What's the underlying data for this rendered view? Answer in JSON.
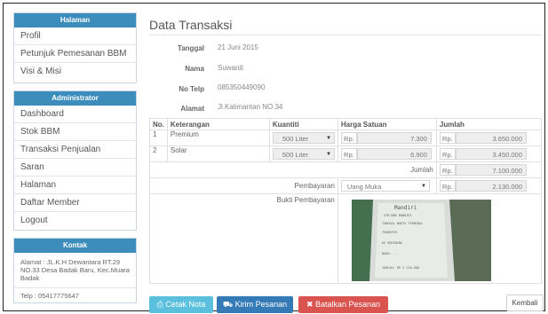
{
  "sidebar": {
    "halaman_title": "Halaman",
    "halaman_items": [
      "Profil",
      "Petunjuk Pemesanan BBM",
      "Visi & Misi"
    ],
    "admin_title": "Administrator",
    "admin_items": [
      "Dashboard",
      "Stok BBM",
      "Transaksi Penjualan",
      "Saran",
      "Halaman",
      "Daftar Member",
      "Logout"
    ],
    "kontak_title": "Kontak",
    "kontak_address": "Alamat : JL.K.H Dewantara RT.29 NO.33 Desa Badak Baru, Kec.Muara Badak",
    "kontak_phone": "Telp : 05417775647"
  },
  "main": {
    "title": "Data Transaksi",
    "info": {
      "tanggal_label": "Tanggal",
      "tanggal": "21 Juni 2015",
      "nama_label": "Nama",
      "nama": "Suwardi",
      "notelp_label": "No Telp",
      "notelp": "085350449090",
      "alamat_label": "Alamat",
      "alamat": "Jl.Kalimantan NO.34"
    },
    "table": {
      "headers": [
        "No.",
        "Keterangan",
        "Kuantiti",
        "Harga Satuan",
        "Jumlah"
      ],
      "rows": [
        {
          "no": "1",
          "keterangan": "Premium",
          "kuantiti": "500 Liter",
          "rp1": "Rp.",
          "harga": "7.300",
          "rp2": "Rp.",
          "jumlah": "3.650.000"
        },
        {
          "no": "2",
          "keterangan": "Solar",
          "kuantiti": "500 Liter",
          "rp1": "Rp.",
          "harga": "6.900",
          "rp2": "Rp.",
          "jumlah": "3.450.000"
        }
      ],
      "jumlah_label": "Jumlah",
      "jumlah_rp": "Rp.",
      "jumlah_total": "7.100.000",
      "pembayaran_label": "Pembayaran",
      "pembayaran_value": "Uang Muka",
      "pembayaran_rp": "Rp.",
      "pembayaran_amount": "2.130.000",
      "bukti_label": "Bukti Pembayaran"
    },
    "receipt_text": [
      "Mandiri",
      "ATM BNK MANDIRI",
      "TANGGAL  WAKTU  TERMINAL",
      "TRANSFER",
      "KE REKENING",
      "NAMA: ...",
      "JUMLAH: RP 2.130.000"
    ]
  },
  "buttons": {
    "cetak": "Cetak Nota",
    "kirim": "Kirim Pesanan",
    "batal": "Batalkan Pesanan",
    "kembali": "Kembali"
  },
  "colors": {
    "panel_header": "#3c8dbc",
    "btn_cetak": "#5bc0de",
    "btn_kirim": "#337ab7",
    "btn_batal": "#d9534f"
  }
}
